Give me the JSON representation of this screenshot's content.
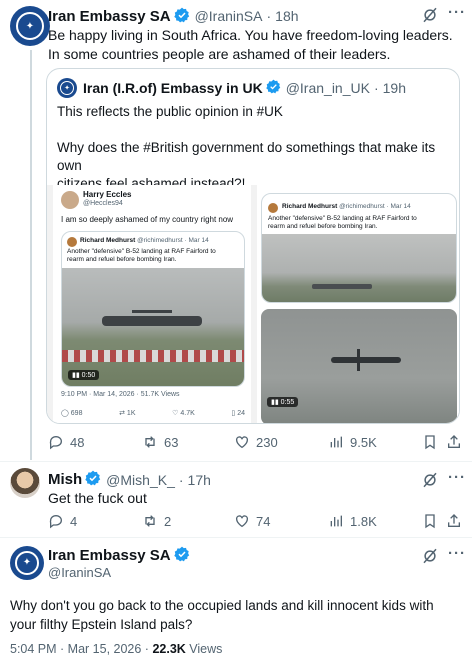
{
  "tweet1": {
    "name": "Iran Embassy SA",
    "handle": "@IraninSA",
    "time": "18h",
    "text_line1": "Be happy living in South Africa. You have freedom-loving leaders.",
    "text_line2": "In some countries people are ashamed of their leaders.",
    "quote": {
      "name": "Iran (I.R.of) Embassy in UK",
      "handle": "@Iran_in_UK",
      "time": "19h",
      "line1": "This reflects the public opinion in #UK",
      "line2": "Why does the #British government do somethings that make its own",
      "line3": "citizens feel ashamed instead?!",
      "line4": "...",
      "left_media": {
        "author": "Harry Eccles",
        "handle": "@Heccles94",
        "text": "I am so deeply ashamed of my country right now",
        "inner_name": "Richard Medhurst",
        "inner_handle": "@richimedhurst · Mar 14",
        "inner_text1": "Another \"defensive\" B-52 landing at RAF Fairford to",
        "inner_text2": "rearm and refuel before bombing Iran.",
        "video_time": "0:50",
        "footer": "9:10 PM · Mar 14, 2026 · 51.7K Views",
        "stats": [
          "698",
          "1K",
          "4.7K",
          "24"
        ]
      },
      "right_media": {
        "inner_name": "Richard Medhurst",
        "inner_handle": "@richimedhurst · Mar 14",
        "inner_text1": "Another \"defensive\" B-52 landing at RAF Fairford to",
        "inner_text2": "rearm and refuel before bombing Iran.",
        "video_time": "0:55"
      }
    },
    "actions": {
      "replies": "48",
      "reposts": "63",
      "likes": "230",
      "views": "9.5K"
    }
  },
  "tweet2": {
    "name": "Mish",
    "handle": "@Mish_K_",
    "time": "17h",
    "text": "Get the fuck out",
    "actions": {
      "replies": "4",
      "reposts": "2",
      "likes": "74",
      "views": "1.8K"
    }
  },
  "tweet3": {
    "name": "Iran Embassy SA",
    "handle": "@IraninSA",
    "text_line1": "Why don't you go back to the occupied lands and kill innocent kids with",
    "text_line2": "your filthy Epstein Island pals?",
    "meta_time": "5:04 PM · Mar 15, 2026 · ",
    "meta_views": "22.3K",
    "meta_views_label": " Views"
  },
  "colors": {
    "verified": "#1d9bf0",
    "muted": "#536471",
    "border": "#cfd9de"
  }
}
